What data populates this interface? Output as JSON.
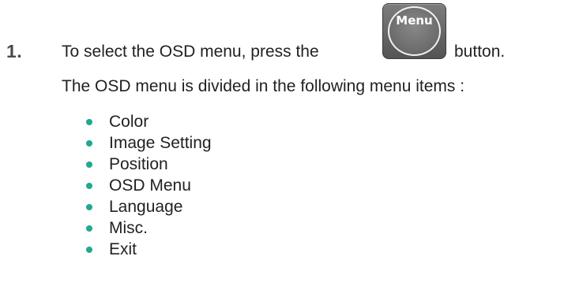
{
  "step": {
    "number": "1.",
    "instruction_before": "To select the OSD menu, press the",
    "button_label": "Menu",
    "instruction_after": "button."
  },
  "intro": "The OSD menu is divided in the following menu items :",
  "menu_items": [
    {
      "label": "Color"
    },
    {
      "label": "Image Setting"
    },
    {
      "label": "Position"
    },
    {
      "label": "OSD Menu"
    },
    {
      "label": "Language"
    },
    {
      "label": "Misc."
    },
    {
      "label": "Exit"
    }
  ],
  "colors": {
    "bullet": "#1fa98e",
    "step_number": "#4a4a4a",
    "button_body": "#5e5e5e"
  }
}
